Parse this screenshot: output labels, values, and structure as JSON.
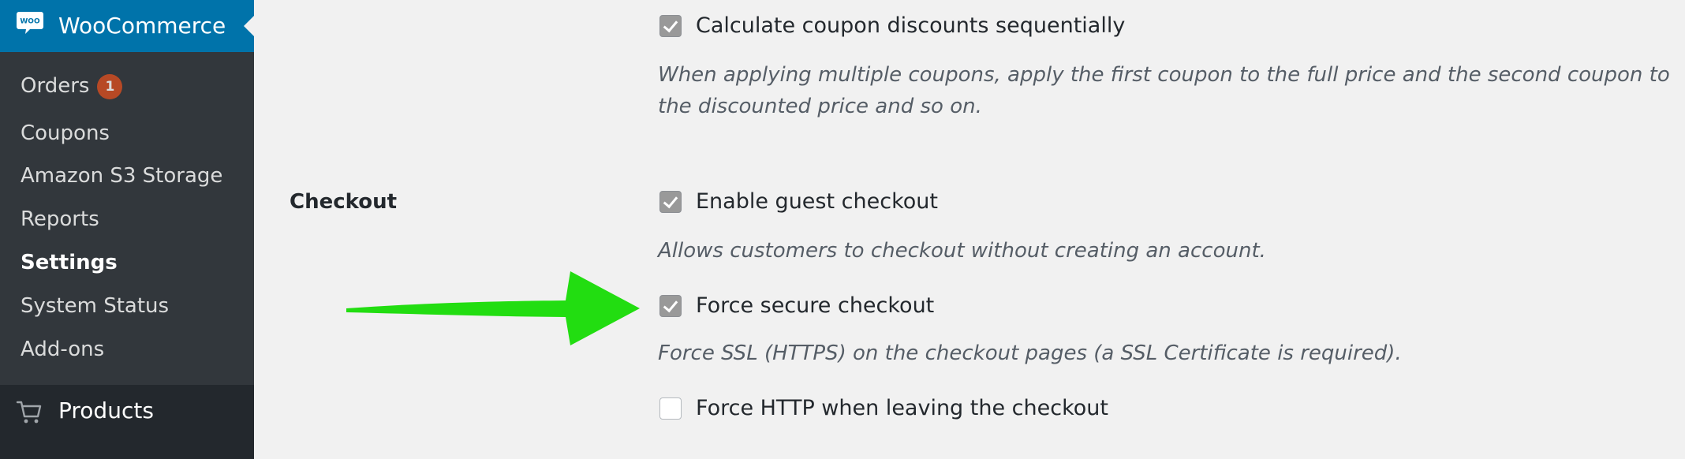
{
  "sidebar": {
    "header_title": "WooCommerce",
    "logo_text": "WOO",
    "items": [
      {
        "label": "Orders",
        "badge": "1"
      },
      {
        "label": "Coupons"
      },
      {
        "label": "Amazon S3 Storage"
      },
      {
        "label": "Reports"
      },
      {
        "label": "Settings",
        "current": true
      },
      {
        "label": "System Status"
      },
      {
        "label": "Add-ons"
      }
    ],
    "products_label": "Products",
    "products_icon": "cart-icon",
    "colors": {
      "sidebar_bg": "#32373c",
      "header_bg": "#0073aa",
      "badge_bg": "#d54e21",
      "products_bg": "#23282d"
    }
  },
  "content": {
    "coupon_option": {
      "label": "Calculate coupon discounts sequentially",
      "checked": true,
      "description": "When applying multiple coupons, apply the first coupon to the full price and the second coupon to the discounted price and so on."
    },
    "checkout_section": {
      "title": "Checkout",
      "options": [
        {
          "label": "Enable guest checkout",
          "checked": true,
          "description": "Allows customers to checkout without creating an account."
        },
        {
          "label": "Force secure checkout",
          "checked": true,
          "description": "Force SSL (HTTPS) on the checkout pages (a SSL Certificate is required)."
        },
        {
          "label": "Force HTTP when leaving the checkout",
          "checked": false
        }
      ]
    },
    "annotation": {
      "arrow_color": "#22dd11",
      "points_to": "Force secure checkout"
    }
  }
}
